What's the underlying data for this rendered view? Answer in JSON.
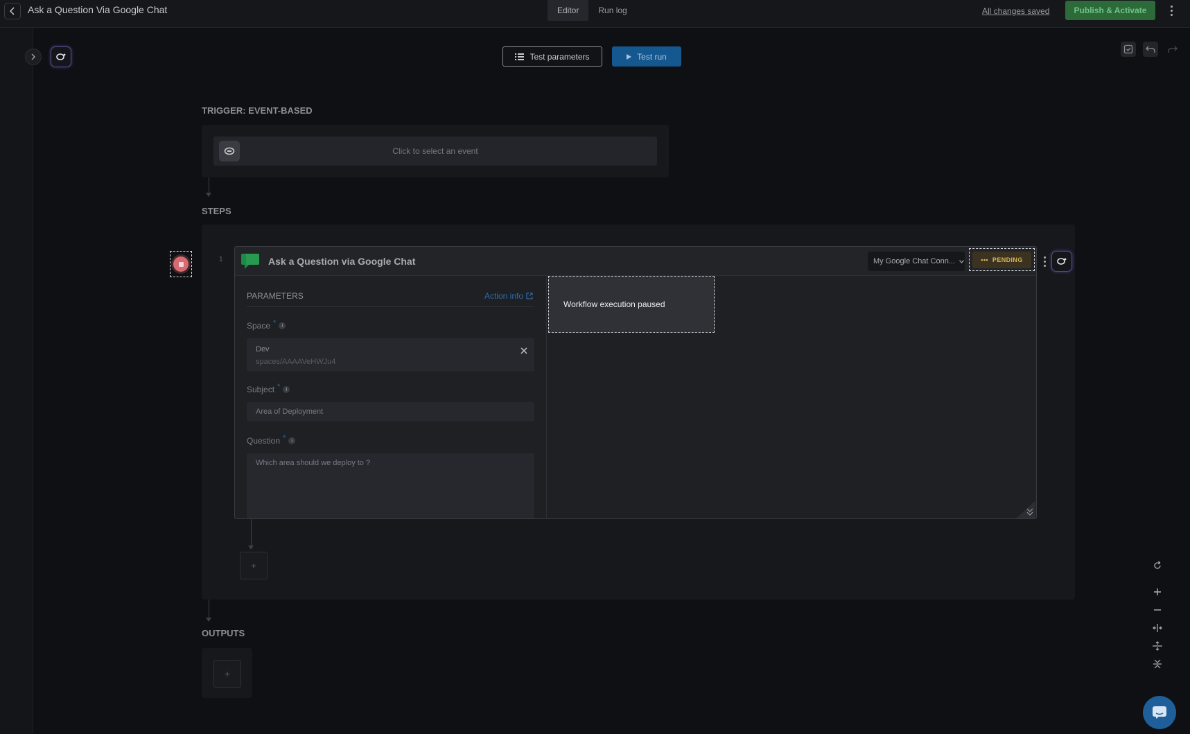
{
  "header": {
    "title": "Ask a Question Via Google Chat",
    "tabs": [
      "Editor",
      "Run log"
    ],
    "saved_label": "All changes saved",
    "publish_label": "Publish & Activate"
  },
  "toolbar": {
    "test_parameters_label": "Test parameters",
    "test_run_label": "Test run"
  },
  "trigger": {
    "section_label": "TRIGGER: EVENT-BASED",
    "select_placeholder": "Click to select an event"
  },
  "steps": {
    "section_label": "STEPS",
    "items": [
      {
        "number": "1",
        "title": "Ask a Question via Google Chat",
        "connection": "My Google Chat Conn...",
        "status": "PENDING",
        "parameters_title": "PARAMETERS",
        "action_info_label": "Action info",
        "fields": {
          "space_label": "Space",
          "space_name": "Dev",
          "space_id": "spaces/AAAAVeHWJu4",
          "subject_label": "Subject",
          "subject_value": "Area of Deployment",
          "question_label": "Question",
          "question_value": "Which area should we deploy to ?"
        },
        "tooltip": "Workflow execution paused"
      }
    ],
    "add_label": "+"
  },
  "outputs": {
    "section_label": "OUTPUTS",
    "add_label": "+"
  },
  "required_mark": "*",
  "info_mark": "i",
  "colors": {
    "accent_blue": "#15578f",
    "publish_green": "#2d6a3a",
    "pending_amber": "#d9b455",
    "stop_red": "#d86a72"
  },
  "icons": {
    "back": "chevron-left-icon",
    "expand": "chevron-right-icon",
    "ai": "ai-assistant-icon",
    "list": "list-icon",
    "play": "play-icon",
    "chat": "google-chat-icon",
    "close": "close-icon",
    "external": "external-link-icon",
    "undo": "undo-icon",
    "redo": "redo-icon",
    "save": "save-icon",
    "reset": "reset-icon",
    "zoom_in": "zoom-in-icon",
    "zoom_out": "zoom-out-icon",
    "support": "support-chat-icon"
  }
}
